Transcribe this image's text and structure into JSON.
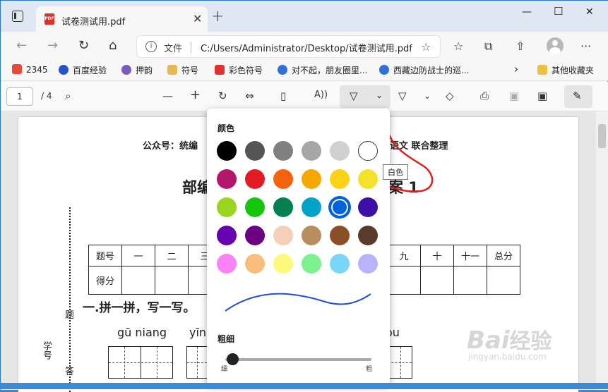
{
  "tab": {
    "title": "试卷测试用.pdf",
    "icon_text": "PDF"
  },
  "address": {
    "label": "文件",
    "path": "C:/Users/Administrator/Desktop/试卷测试用.pdf"
  },
  "bookmarks": [
    {
      "label": "2345",
      "color": "#d33"
    },
    {
      "label": "百度经验",
      "color": "#2553c9"
    },
    {
      "label": "押韵",
      "color": "#7a5bbf"
    },
    {
      "label": "符号",
      "color": "#e0a030"
    },
    {
      "label": "彩色符号",
      "color": "#e23030"
    },
    {
      "label": "对不起，朋友圈里...",
      "color": "#2e6fd8"
    },
    {
      "label": "西藏边防战士的巡...",
      "color": "#2e6fd8"
    }
  ],
  "bookmarks_other": "其他收藏夹",
  "pdf_toolbar": {
    "page": "1",
    "total": "/ 4"
  },
  "doc": {
    "header": "公众号：统编",
    "header_right": "语文  联合整理",
    "title_left": "部编",
    "title_right": "案 1",
    "score_row1": [
      "题号",
      "一",
      "二",
      "三",
      "",
      "",
      "",
      "",
      "",
      "九",
      "十",
      "十一",
      "总分"
    ],
    "score_row2_label": "得分",
    "section1": "一.拼一拼，写一写。",
    "pinyin": [
      "gū  niang",
      "yīn",
      "ou"
    ],
    "side_labels": [
      "题",
      "学号",
      "答"
    ]
  },
  "popup": {
    "color_label": "颜色",
    "thickness_label": "粗细",
    "thin": "细",
    "thick": "粗",
    "tooltip": "白色",
    "swatches": [
      "#000000",
      "#555555",
      "#808080",
      "#a6a6a6",
      "#d0d0d0",
      "#ffffff",
      "#b5156b",
      "#e31b23",
      "#f7630c",
      "#f7a800",
      "#fcd116",
      "#f2e32a",
      "#9bd41e",
      "#16c60c",
      "#038150",
      "#00a3c8",
      "#0063db",
      "#3c0fa8",
      "#6700b0",
      "#6b0083",
      "#f6cfba",
      "#b98e5e",
      "#8b4f27",
      "#5a3a2a",
      "#f982f5",
      "#f9be7c",
      "#fdf97d",
      "#7bf28e",
      "#79d5f9",
      "#b9b4fa"
    ],
    "selected_index": 16,
    "stroke_color": "#1e4fce",
    "thickness_value": 0.05
  },
  "watermark": {
    "brand": "Bai",
    "brand2": "经验",
    "url": "jingyan.baidu.com"
  }
}
